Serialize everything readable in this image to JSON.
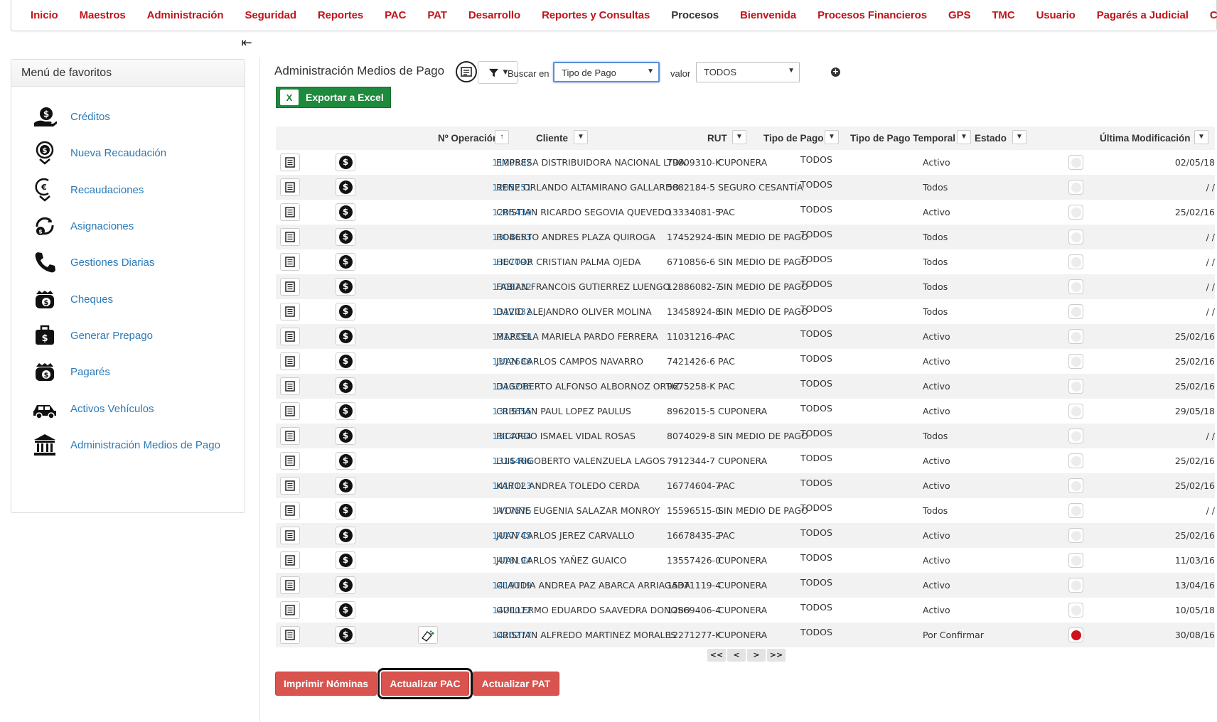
{
  "nav": {
    "items": [
      {
        "label": "Inicio",
        "dark": false
      },
      {
        "label": "Maestros",
        "dark": false
      },
      {
        "label": "Administración",
        "dark": false
      },
      {
        "label": "Seguridad",
        "dark": false
      },
      {
        "label": "Reportes",
        "dark": false
      },
      {
        "label": "PAC",
        "dark": false
      },
      {
        "label": "PAT",
        "dark": false
      },
      {
        "label": "Desarrollo",
        "dark": false
      },
      {
        "label": "Reportes y Consultas",
        "dark": false
      },
      {
        "label": "Procesos",
        "dark": true
      },
      {
        "label": "Bienvenida",
        "dark": false
      },
      {
        "label": "Procesos Financieros",
        "dark": false
      },
      {
        "label": "GPS",
        "dark": false
      },
      {
        "label": "TMC",
        "dark": false
      },
      {
        "label": "Usuario",
        "dark": false
      },
      {
        "label": "Pagarés a Judicial",
        "dark": false
      },
      {
        "label": "Contabilidad",
        "dark": false
      }
    ],
    "collapse_icon": "collapse-left-icon"
  },
  "sidebar": {
    "header": "Menú de favoritos",
    "items": [
      {
        "label": "Créditos",
        "icon": "credit-hand-icon"
      },
      {
        "label": "Nueva Recaudación",
        "icon": "new-collection-icon"
      },
      {
        "label": "Recaudaciones",
        "icon": "collections-icon"
      },
      {
        "label": "Asignaciones",
        "icon": "assignments-icon"
      },
      {
        "label": "Gestiones Diarias",
        "icon": "phone-icon"
      },
      {
        "label": "Cheques",
        "icon": "money-bag-icon"
      },
      {
        "label": "Generar Prepago",
        "icon": "briefcase-money-icon"
      },
      {
        "label": "Pagarés",
        "icon": "money-bag-icon"
      },
      {
        "label": "Activos Vehículos",
        "icon": "car-icon"
      },
      {
        "label": "Administración Medios de Pago",
        "icon": "bank-icon"
      }
    ]
  },
  "toolbar": {
    "title": "Administración Medios de Pago",
    "buscar_label": "Buscar en",
    "buscar_value": "Tipo de Pago",
    "valor_label": "valor",
    "valor_value": "TODOS",
    "excel_label": "Exportar a Excel"
  },
  "table": {
    "columns": {
      "operacion": "Nº Operación",
      "cliente": "Cliente",
      "rut": "RUT",
      "tipo_pago": "Tipo de Pago",
      "tipo_pago_temporal": "Tipo de Pago Temporal",
      "estado": "Estado",
      "ultima_mod": "Última Modificación"
    },
    "rows": [
      {
        "op": "1100582",
        "cliente": "EMPRESA DISTRIBUIDORA NACIONAL LTDA",
        "rut": "79809310-K",
        "tipo": "CUPONERA",
        "temp": "TODOS",
        "estado": "Activo",
        "fecha": "02/05/18",
        "dot": "grey",
        "approve": false
      },
      {
        "op": "1205251",
        "cliente": "RENE ORLANDO ALTAMIRANO GALLARDO",
        "rut": "5882184-5",
        "tipo": "SEGURO CESANTÍA",
        "temp": "TODOS",
        "estado": "Todos",
        "fecha": "/ /",
        "dot": "grey",
        "approve": false
      },
      {
        "op": "1205439",
        "cliente": "CRISTIAN RICARDO SEGOVIA QUEVEDO",
        "rut": "13334081-5",
        "tipo": "PAC",
        "temp": "TODOS",
        "estado": "Activo",
        "fecha": "25/02/16",
        "dot": "grey",
        "approve": false
      },
      {
        "op": "1304653",
        "cliente": "ROBERTO ANDRES PLAZA QUIROGA",
        "rut": "17452924-8",
        "tipo": "SIN MEDIO DE PAGO",
        "temp": "TODOS",
        "estado": "Todos",
        "fecha": "/ /",
        "dot": "grey",
        "approve": false
      },
      {
        "op": "1307092",
        "cliente": "HECTOR CRISTIAN PALMA OJEDA",
        "rut": "6710856-6",
        "tipo": "SIN MEDIO DE PAGO",
        "temp": "TODOS",
        "estado": "Todos",
        "fecha": "/ /",
        "dot": "grey",
        "approve": false
      },
      {
        "op": "1308732",
        "cliente": "FABIAN FRANCOIS GUTIERREZ LUENGO",
        "rut": "12886082-7",
        "tipo": "SIN MEDIO DE PAGO",
        "temp": "TODOS",
        "estado": "Todos",
        "fecha": "/ /",
        "dot": "grey",
        "approve": false
      },
      {
        "op": "1312032",
        "cliente": "DAVID ALEJANDRO OLIVER MOLINA",
        "rut": "13458924-8",
        "tipo": "SIN MEDIO DE PAGO",
        "temp": "TODOS",
        "estado": "Todos",
        "fecha": "/ /",
        "dot": "grey",
        "approve": false
      },
      {
        "op": "1312358",
        "cliente": "MARCELA MARIELA PARDO FERRERA",
        "rut": "11031216-4",
        "tipo": "PAC",
        "temp": "TODOS",
        "estado": "Activo",
        "fecha": "25/02/16",
        "dot": "grey",
        "approve": false
      },
      {
        "op": "1312686",
        "cliente": "JUAN CARLOS CAMPOS NAVARRO",
        "rut": "7421426-6",
        "tipo": "PAC",
        "temp": "TODOS",
        "estado": "Activo",
        "fecha": "25/02/16",
        "dot": "grey",
        "approve": false
      },
      {
        "op": "1313296",
        "cliente": "DAGOBERTO ALFONSO ALBORNOZ ORTIZ",
        "rut": "9675258-K",
        "tipo": "PAC",
        "temp": "TODOS",
        "estado": "Activo",
        "fecha": "25/02/16",
        "dot": "grey",
        "approve": false
      },
      {
        "op": "1313655",
        "cliente": "CRISTIAN PAUL LOPEZ PAULUS",
        "rut": "8962015-5",
        "tipo": "CUPONERA",
        "temp": "TODOS",
        "estado": "Activo",
        "fecha": "29/05/18",
        "dot": "grey",
        "approve": false
      },
      {
        "op": "1314094",
        "cliente": "RICARDO ISMAEL VIDAL ROSAS",
        "rut": "8074029-8",
        "tipo": "SIN MEDIO DE PAGO",
        "temp": "TODOS",
        "estado": "Todos",
        "fecha": "/ /",
        "dot": "grey",
        "approve": false
      },
      {
        "op": "1314466",
        "cliente": "LUIS RIGOBERTO VALENZUELA LAGOS",
        "rut": "7912344-7",
        "tipo": "CUPONERA",
        "temp": "TODOS",
        "estado": "Activo",
        "fecha": "25/02/16",
        "dot": "grey",
        "approve": false
      },
      {
        "op": "1417123",
        "cliente": "KAROL ANDREA TOLEDO CERDA",
        "rut": "16774604-7",
        "tipo": "PAC",
        "temp": "TODOS",
        "estado": "Activo",
        "fecha": "25/02/16",
        "dot": "grey",
        "approve": false
      },
      {
        "op": "1417575",
        "cliente": "IVONNE EUGENIA SALAZAR MONROY",
        "rut": "15596515-0",
        "tipo": "SIN MEDIO DE PAGO",
        "temp": "TODOS",
        "estado": "Todos",
        "fecha": "/ /",
        "dot": "grey",
        "approve": false
      },
      {
        "op": "1417745",
        "cliente": "JUAN CARLOS JEREZ CARVALLO",
        "rut": "16678435-2",
        "tipo": "PAC",
        "temp": "TODOS",
        "estado": "Activo",
        "fecha": "25/02/16",
        "dot": "grey",
        "approve": false
      },
      {
        "op": "1418194",
        "cliente": "JUAN CARLOS YAÑEZ GUAICO",
        "rut": "13557426-0",
        "tipo": "CUPONERA",
        "temp": "TODOS",
        "estado": "Activo",
        "fecha": "11/03/16",
        "dot": "grey",
        "approve": false
      },
      {
        "op": "1419119",
        "cliente": "CLAUDIA ANDREA PAZ ABARCA ARRIAGADA",
        "rut": "15371119-4",
        "tipo": "CUPONERA",
        "temp": "TODOS",
        "estado": "Activo",
        "fecha": "13/04/16",
        "dot": "grey",
        "approve": false
      },
      {
        "op": "1420072",
        "cliente": "GUILLERMO EDUARDO SAAVEDRA DONOSO",
        "rut": "12869406-4",
        "tipo": "CUPONERA",
        "temp": "TODOS",
        "estado": "Activo",
        "fecha": "10/05/18",
        "dot": "grey",
        "approve": false
      },
      {
        "op": "1420277",
        "cliente": "CRISTIAN ALFREDO MARTINEZ MORALES",
        "rut": "12271277-K",
        "tipo": "CUPONERA",
        "temp": "TODOS",
        "estado": "Por Confirmar",
        "fecha": "30/08/16",
        "dot": "red",
        "approve": true
      }
    ]
  },
  "pager": {
    "first": "<<",
    "prev": "<",
    "next": ">",
    "last": ">>"
  },
  "buttons": {
    "imprimir": "Imprimir Nóminas",
    "actualizar_pac": "Actualizar PAC",
    "actualizar_pat": "Actualizar PAT"
  },
  "colors": {
    "nav_red": "#c0141b",
    "link_blue": "#2a7ab8",
    "excel_green": "#1e8a3c",
    "button_red": "#d9534f",
    "status_red": "#d0101b"
  }
}
